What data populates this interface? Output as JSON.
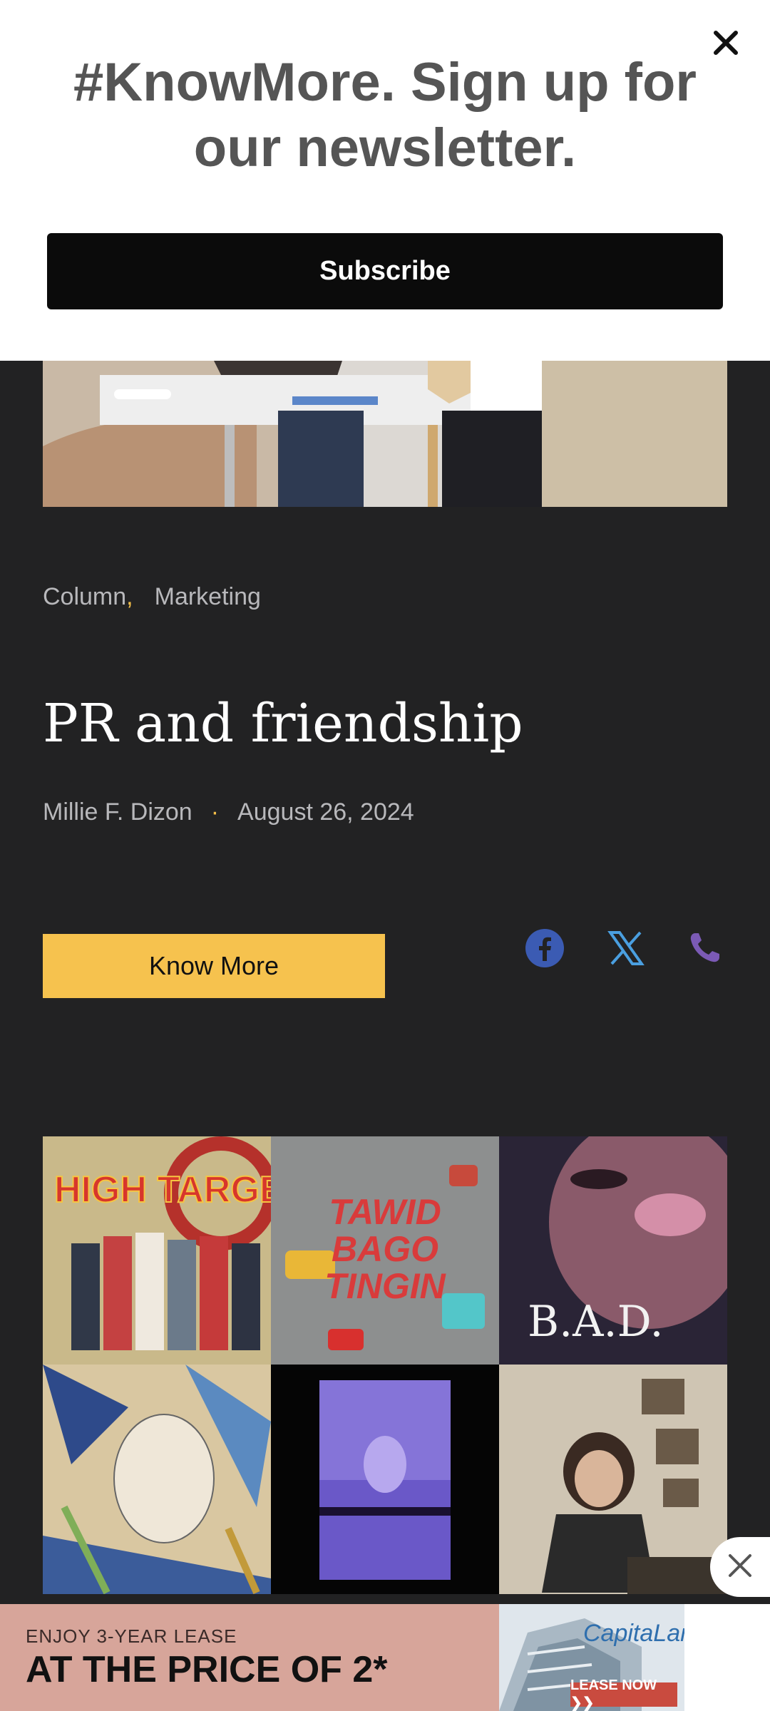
{
  "newsletter": {
    "heading": "#KnowMore. Sign up for our newsletter.",
    "subscribe_label": "Subscribe"
  },
  "article": {
    "categories": [
      "Column",
      "Marketing"
    ],
    "title": "PR and friendship",
    "author": "Millie F. Dizon",
    "date": "August 26, 2024",
    "know_more_label": "Know More"
  },
  "share": {
    "icons": [
      "facebook-icon",
      "x-twitter-icon",
      "phone-icon"
    ],
    "colors": {
      "facebook": "#3b5bb3",
      "x": "#4a9fe0",
      "phone": "#7b5ab5"
    }
  },
  "grid": {
    "tiles": [
      {
        "caption": "HIGH TARGETS"
      },
      {
        "caption": "TAWID BAGO TINGIN"
      },
      {
        "caption": "B.A.D."
      },
      {
        "caption": ""
      },
      {
        "caption": ""
      },
      {
        "caption": ""
      }
    ]
  },
  "ad": {
    "small_text": "ENJOY 3-YEAR LEASE",
    "big_text": "AT THE PRICE OF 2*",
    "brand": "CapitaLand",
    "cta": "LEASE NOW ❯❯"
  },
  "colors": {
    "accent": "#f6c24e",
    "background": "#222223",
    "muted_text": "#b8b8bb"
  }
}
